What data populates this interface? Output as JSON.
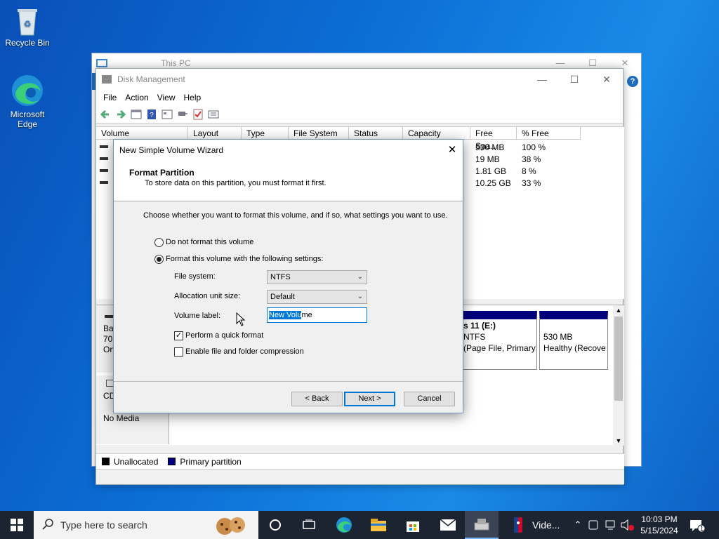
{
  "desktop": {
    "icons": [
      {
        "label": "Recycle Bin"
      },
      {
        "label": "Microsoft Edge"
      }
    ]
  },
  "thispc_window": {
    "title": "This PC"
  },
  "disk_management": {
    "title": "Disk Management",
    "menu": [
      "File",
      "Action",
      "View",
      "Help"
    ],
    "columns": [
      "Volume",
      "Layout",
      "Type",
      "File System",
      "Status",
      "Capacity",
      "Free Spa...",
      "% Free"
    ],
    "rows": [
      {
        "free": "530 MB",
        "pct": "100 %"
      },
      {
        "free": "19 MB",
        "pct": "38 %"
      },
      {
        "free": "1.81 GB",
        "pct": "8 %"
      },
      {
        "free": "10.25 GB",
        "pct": "33 %"
      }
    ],
    "graph": {
      "disk0_left": [
        "Ba",
        "70.",
        "On"
      ],
      "partition_e": {
        "name": "s 11  (E:)",
        "fs": "NTFS",
        "status": "(Page File, Primary"
      },
      "partition_recovery": {
        "size": "530 MB",
        "status": "Healthy (Recove"
      },
      "cd_label": "CD",
      "cd_media": "No Media"
    },
    "legend": [
      {
        "label": "Unallocated",
        "color": "#000000"
      },
      {
        "label": "Primary partition",
        "color": "#000080"
      }
    ]
  },
  "wizard": {
    "title": "New Simple Volume Wizard",
    "heading": "Format Partition",
    "subheading": "To store data on this partition, you must format it first.",
    "instruction": "Choose whether you want to format this volume, and if so, what settings you want to use.",
    "option_no_format": "Do not format this volume",
    "option_format": "Format this volume with the following settings:",
    "file_system_label": "File system:",
    "file_system_value": "NTFS",
    "alloc_label": "Allocation unit size:",
    "alloc_value": "Default",
    "volume_label_label": "Volume label:",
    "volume_label_selected": "New Volu",
    "volume_label_rest": "me",
    "quick_format": "Perform a quick format",
    "compression": "Enable file and folder compression",
    "back_button": "< Back",
    "next_button": "Next >",
    "cancel_button": "Cancel"
  },
  "taskbar": {
    "search_placeholder": "Type here to search",
    "video_label": "Vide...",
    "time": "10:03 PM",
    "date": "5/15/2024",
    "notification_count": "1"
  }
}
